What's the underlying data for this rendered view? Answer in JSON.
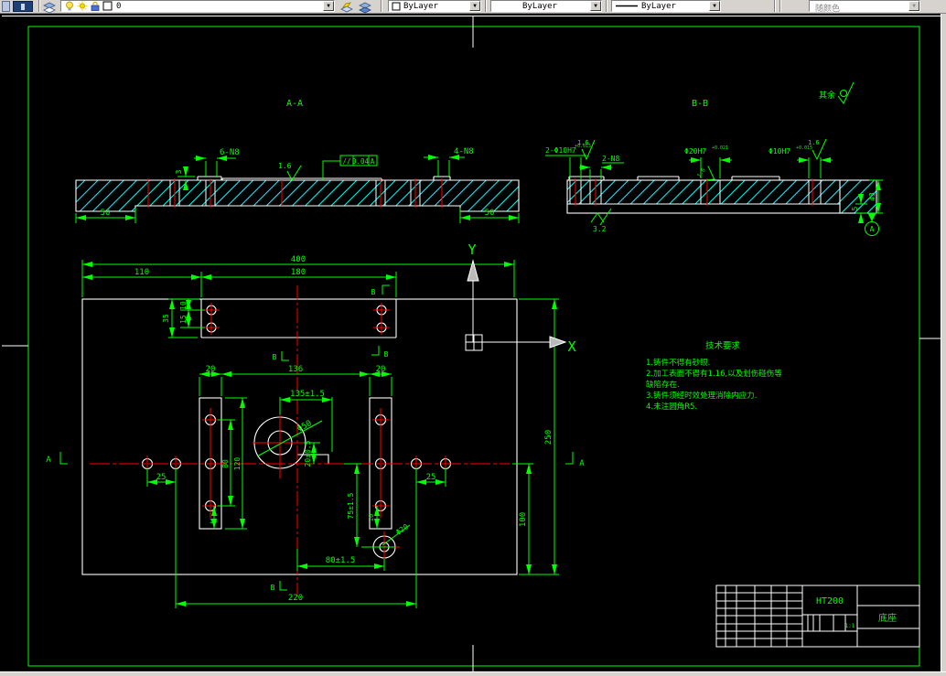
{
  "toolbar": {
    "layer_value": "0",
    "color_value": "ByLayer",
    "linetype_value": "ByLayer",
    "lineweight_value": "ByLayer",
    "plot_style_value": "随颜色"
  },
  "drawing": {
    "section_aa": {
      "title": "A-A",
      "dim_6n8": "6-N8",
      "dim_3": "3",
      "rough": "1.6",
      "fcf_symbol": "//",
      "fcf_value": "0.04",
      "fcf_datum": "A",
      "dim_4n8": "4-N8",
      "dim_50_left": "50",
      "dim_50_right": "50"
    },
    "section_bb": {
      "title": "B-B",
      "dim_left": "2-Φ10H7",
      "dim_left_tol": "+0.015",
      "rough_left": "1.6",
      "dim_n8": "2-N8",
      "dim_mid": "Φ20H7",
      "dim_mid_tol": "+0.021",
      "rough_mid": "1.6",
      "dim_right": "Φ10H7",
      "dim_right_tol": "+0.015",
      "rough_right": "1.6",
      "rough_bottom": "3.2",
      "dim_43": "43",
      "dim_5": "5",
      "datum": "A"
    },
    "rest_roughness": "其余",
    "plan": {
      "dim_400": "400",
      "dim_110": "110",
      "dim_180": "180",
      "dim_35": "35",
      "dim_15": "15",
      "dim_10_top": "10",
      "dim_20_left": "20",
      "dim_136": "136",
      "dim_20_right": "20",
      "dim_135": "135±1.5",
      "dia_50": "Φ50",
      "dim_20_05": "20±0.5",
      "dim_80": "80",
      "dim_120": "120",
      "dim_10_left": "10",
      "dim_10_right": "10",
      "dim_25_left": "25",
      "dim_25_right": "25",
      "dim_75": "75±1.5",
      "dia_20": "Φ20",
      "dim_80_15": "80±1.5",
      "dim_220": "220",
      "dim_250": "250",
      "dim_100": "100",
      "marker_a": "A",
      "marker_b": "B"
    },
    "ucs": {
      "x": "X",
      "y": "Y"
    }
  },
  "notes": {
    "title": "技术要求",
    "lines": [
      "1.铸件不得有砂眼.",
      "2.加工表面不得有1.16,以及划伤碰伤等",
      "缺陷存在.",
      "3.铸件须经时效处理消除内应力.",
      "4.未注圆角R5."
    ]
  },
  "title_block": {
    "material": "HT200",
    "part_name": "底座",
    "scale": "1:1"
  },
  "colors": {
    "line_green": "#00ff00",
    "line_red": "#ff0000",
    "hatch_cyan": "#00ffff",
    "line_white": "#ffffff",
    "toolbar_gray": "#d6d3ce"
  }
}
